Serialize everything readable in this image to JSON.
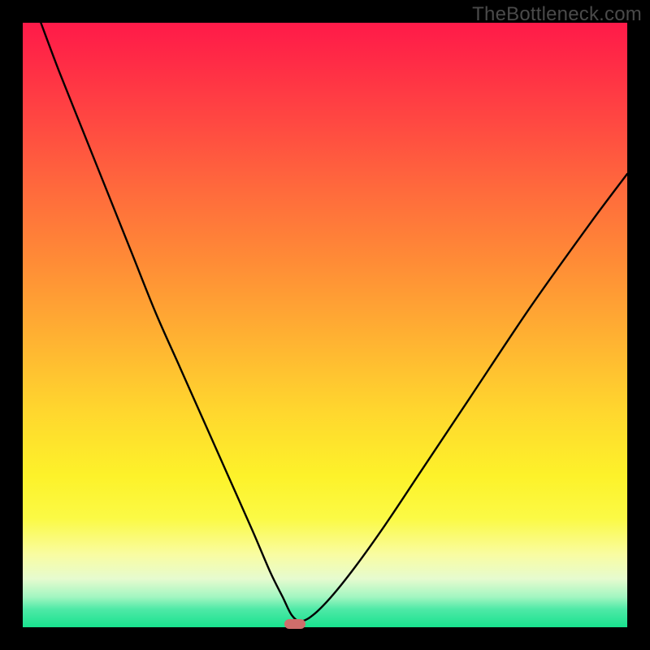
{
  "watermark": "TheBottleneck.com",
  "chart_data": {
    "type": "line",
    "title": "",
    "xlabel": "",
    "ylabel": "",
    "xlim": [
      0,
      100
    ],
    "ylim": [
      0,
      100
    ],
    "grid": false,
    "legend": false,
    "series": [
      {
        "name": "bottleneck-curve",
        "x": [
          3,
          6,
          10,
          14,
          18,
          22,
          26,
          30,
          34,
          38,
          41,
          43,
          44.5,
          46,
          48,
          51,
          55,
          60,
          66,
          74,
          84,
          94,
          100
        ],
        "y": [
          100,
          92,
          82,
          72,
          62,
          52,
          43,
          34,
          25,
          16,
          9,
          5,
          2,
          1,
          2,
          5,
          10,
          17,
          26,
          38,
          53,
          67,
          75
        ]
      }
    ],
    "marker": {
      "x": 45,
      "y": 0.5
    },
    "gradient_stops": [
      {
        "pos": 0,
        "color": "#ff1a49"
      },
      {
        "pos": 16,
        "color": "#ff4742"
      },
      {
        "pos": 40,
        "color": "#ff8d36"
      },
      {
        "pos": 64,
        "color": "#ffd62e"
      },
      {
        "pos": 88,
        "color": "#f9fca2"
      },
      {
        "pos": 100,
        "color": "#18e28e"
      }
    ]
  }
}
